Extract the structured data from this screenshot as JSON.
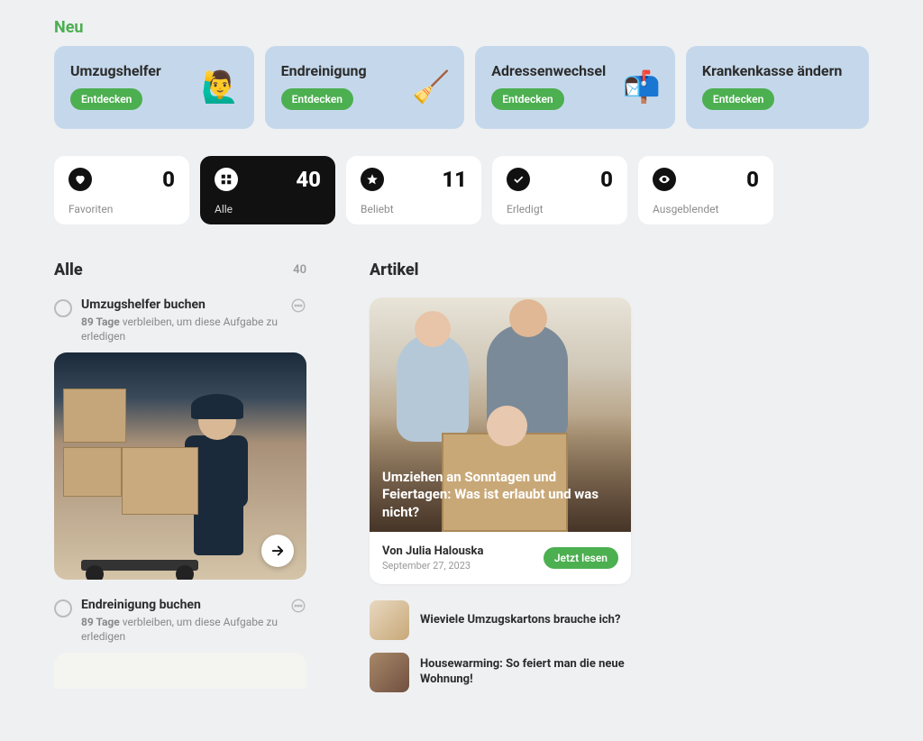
{
  "neu_label": "Neu",
  "discover_label": "Entdecken",
  "promos": [
    {
      "title": "Umzugshelfer",
      "icon": "🙋‍♂️"
    },
    {
      "title": "Endreinigung",
      "icon": "🧹"
    },
    {
      "title": "Adressenwechsel",
      "icon": "📬"
    },
    {
      "title": "Krankenkasse ändern",
      "icon": ""
    }
  ],
  "filters": [
    {
      "label": "Favoriten",
      "count": "0"
    },
    {
      "label": "Alle",
      "count": "40"
    },
    {
      "label": "Beliebt",
      "count": "11"
    },
    {
      "label": "Erledigt",
      "count": "0"
    },
    {
      "label": "Ausgeblendet",
      "count": "0"
    }
  ],
  "list": {
    "header": "Alle",
    "count": "40",
    "tasks": [
      {
        "title": "Umzugshelfer buchen",
        "days": "89 Tage",
        "rest": " verbleiben, um diese Aufgabe zu erledigen"
      },
      {
        "title": "Endreinigung buchen",
        "days": "89 Tage",
        "rest": " verbleiben, um diese Aufgabe zu erledigen"
      }
    ]
  },
  "articles": {
    "header": "Artikel",
    "featured": {
      "title": "Umziehen an Sonntagen und Feiertagen: Was ist erlaubt und was nicht?",
      "author": "Von Julia Halouska",
      "date": "September 27, 2023",
      "cta": "Jetzt lesen"
    },
    "list": [
      {
        "title": "Wieviele Umzugskartons brauche ich?"
      },
      {
        "title": "Housewarming: So feiert man die neue Wohnung!"
      }
    ]
  }
}
